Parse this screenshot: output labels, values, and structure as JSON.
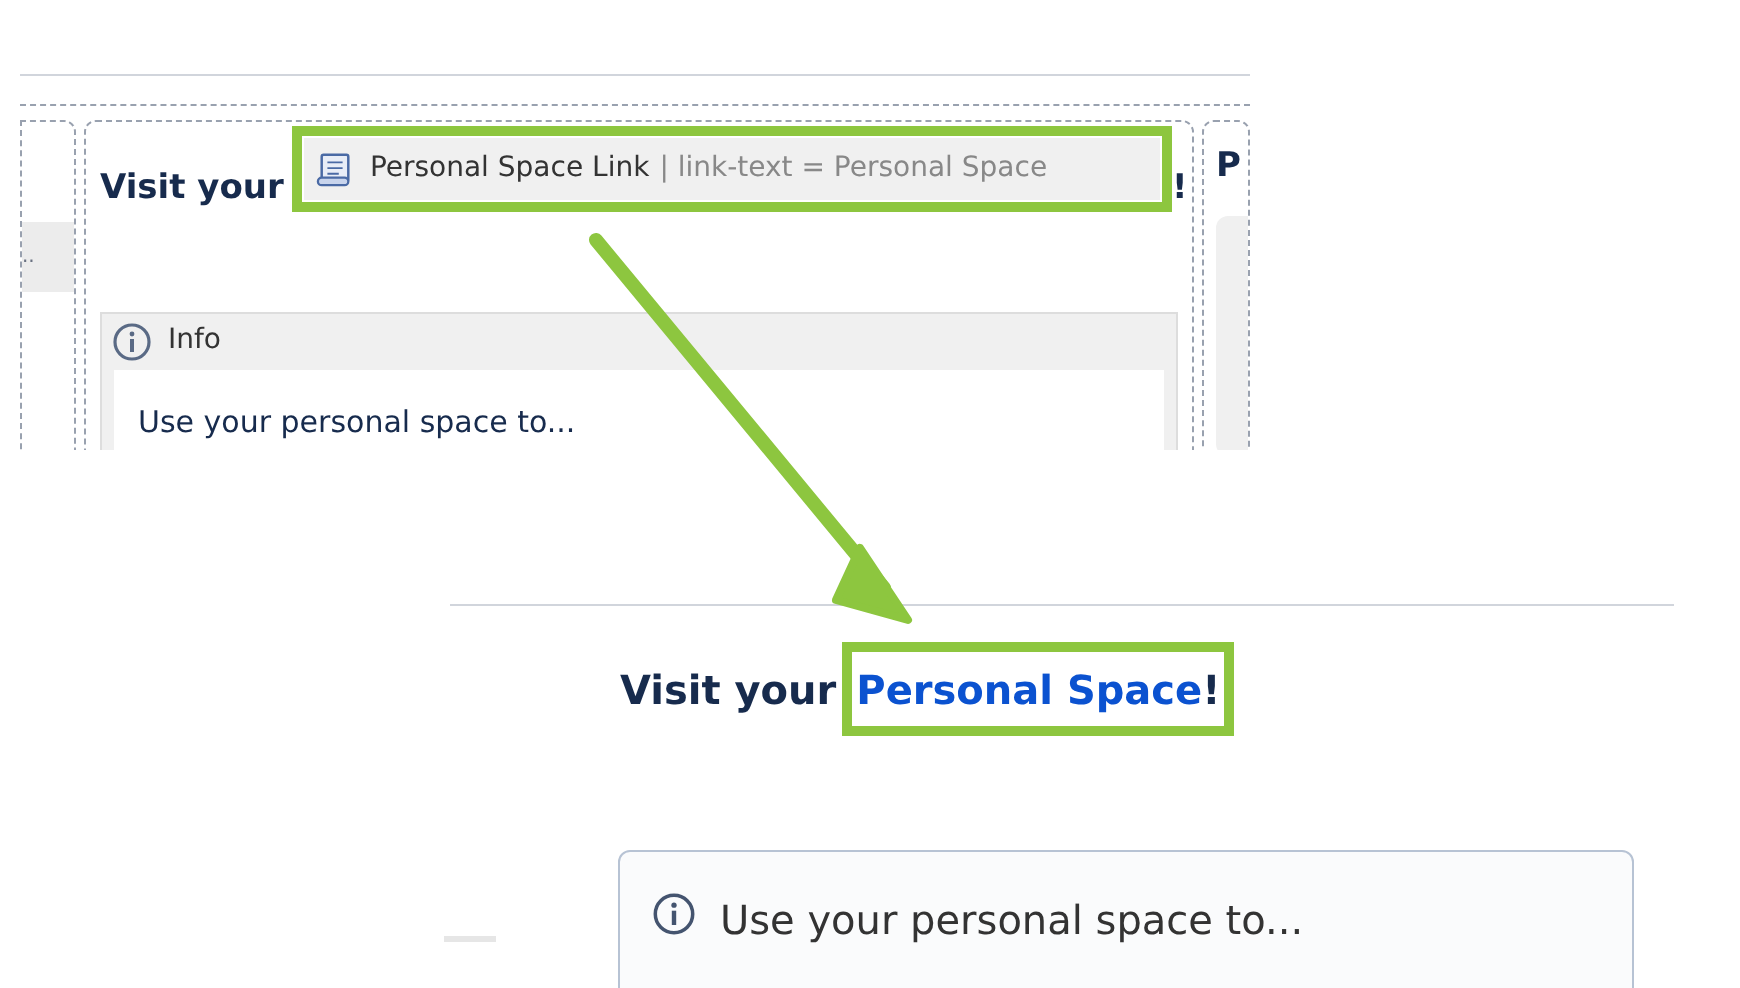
{
  "editor_view": {
    "heading_prefix": "Visit your",
    "macro_chip": {
      "title": "Personal Space Link",
      "params": "| link-text = Personal Space"
    },
    "heading_suffix": "!",
    "left_button": "..",
    "right_column_heading": "P",
    "info_panel": {
      "title": "Info",
      "body": "Use your personal space to..."
    }
  },
  "rendered_view": {
    "heading_prefix": "Visit your",
    "link": "Personal Space",
    "heading_suffix": "!",
    "info_panel": {
      "body": "Use your personal space to..."
    }
  }
}
